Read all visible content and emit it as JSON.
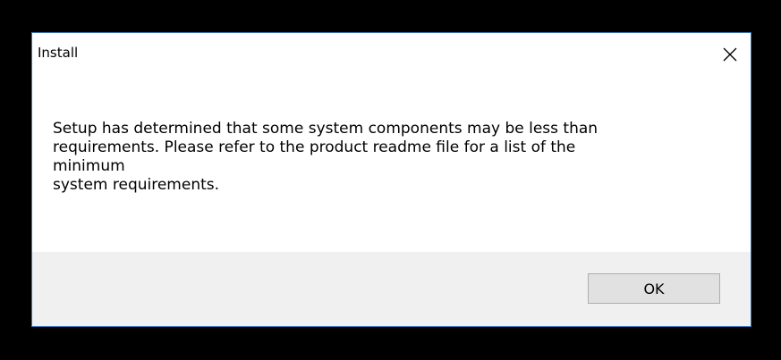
{
  "dialog": {
    "title": "Install",
    "message": "Setup has determined that some system components may be less than\nrequirements.  Please refer to the product readme file for a list of the\nminimum\nsystem requirements.",
    "ok_label": "OK"
  },
  "colors": {
    "backdrop": "#000000",
    "dialog_border": "#3c78b4",
    "button_area": "#f0f0f0",
    "button_face": "#e1e1e1"
  },
  "icons": {
    "close": "close-icon"
  }
}
